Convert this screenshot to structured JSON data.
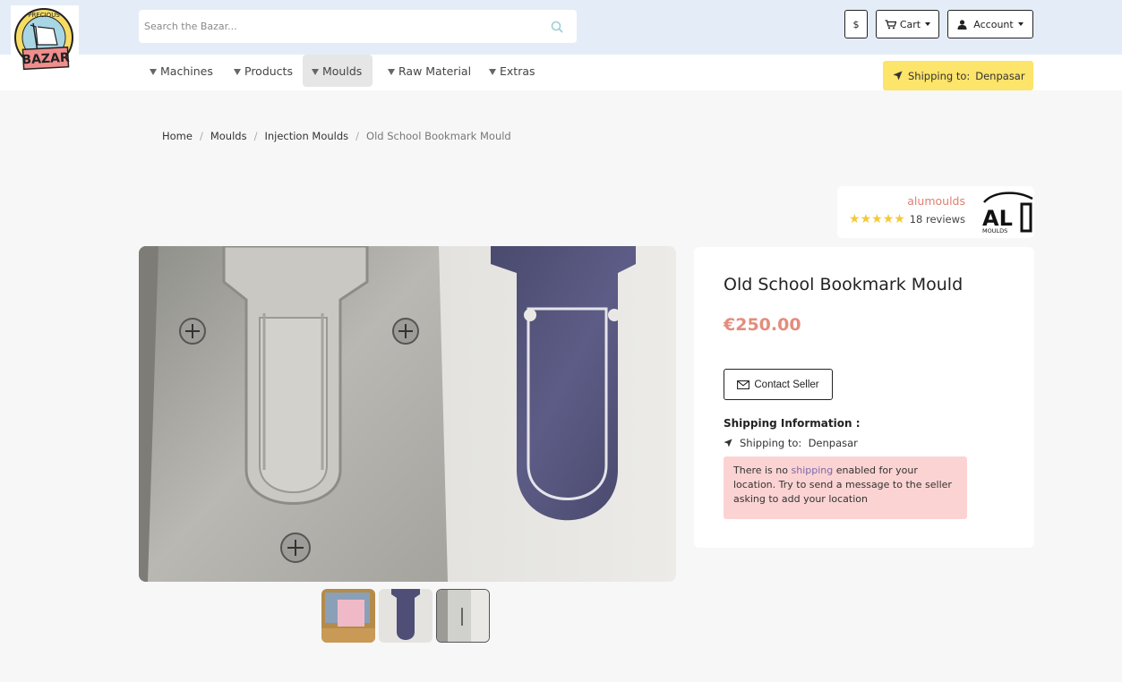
{
  "header": {
    "logo_text_top": "PRECIOUS",
    "logo_text_bottom": "BAZAR",
    "search_placeholder": "Search the Bazar...",
    "currency_label": "$",
    "cart_label": "Cart",
    "account_label": "Account"
  },
  "nav": {
    "items": [
      {
        "label": "Machines",
        "active": false
      },
      {
        "label": "Products",
        "active": false
      },
      {
        "label": "Moulds",
        "active": true
      },
      {
        "label": "Raw Material",
        "active": false
      },
      {
        "label": "Extras",
        "active": false
      }
    ],
    "shipping_label": "Shipping to:",
    "shipping_location": "Denpasar"
  },
  "breadcrumb": {
    "home": "Home",
    "category": "Moulds",
    "subcategory": "Injection Moulds",
    "current": "Old School Bookmark Mould"
  },
  "seller": {
    "name": "alumoulds",
    "rating": 5,
    "reviews": "18 reviews",
    "logo_text": "AL",
    "logo_sub": "MOULDS"
  },
  "product": {
    "title": "Old School Bookmark Mould",
    "price": "€250.00",
    "contact_label": "Contact Seller",
    "shipping_heading": "Shipping Information :",
    "shipping_label": "Shipping to:",
    "shipping_location": "Denpasar",
    "alert_pre": "There is no ",
    "alert_link": "shipping",
    "alert_post": " enabled for your location. Try to send a message to the seller asking to add your location"
  },
  "thumbnails": [
    "thumb-1",
    "thumb-2",
    "thumb-3"
  ],
  "colors": {
    "topbar": "#e4edf7",
    "shipping_button": "#fde46a",
    "price": "#e48c7c",
    "seller_name": "#e07f6f",
    "alert": "#fcd3d3"
  }
}
